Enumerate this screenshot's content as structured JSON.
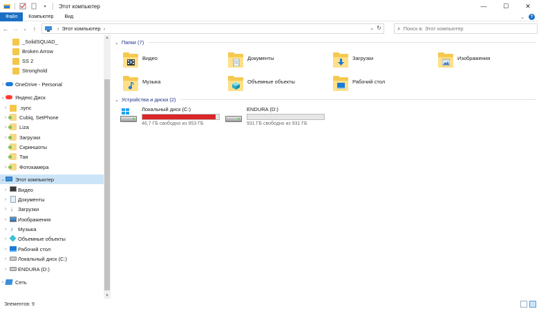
{
  "window": {
    "title": "Этот компьютер",
    "controls": {
      "minimize": "—",
      "maximize": "☐",
      "close": "✕"
    }
  },
  "ribbon": {
    "tabs": [
      "Файл",
      "Компьютер",
      "Вид"
    ],
    "active_tab": 0,
    "expand_icon": "chevron-down-icon",
    "help_icon": "help-icon"
  },
  "navigation": {
    "back": "←",
    "forward": "→",
    "recent": "⌄",
    "up": "↑",
    "address_segments": [
      "Этот компьютер"
    ],
    "search_placeholder": "Поиск в: Этот компьютер"
  },
  "sidebar": {
    "items": [
      {
        "label": "_SolidSQUAD_",
        "icon": "folder-icon",
        "expandable": false,
        "indent": 1
      },
      {
        "label": "Broken Arrow",
        "icon": "folder-icon",
        "expandable": false,
        "indent": 1
      },
      {
        "label": "SS 2",
        "icon": "folder-icon",
        "expandable": false,
        "indent": 1
      },
      {
        "label": "Stronghold",
        "icon": "folder-icon",
        "expandable": false,
        "indent": 1
      },
      {
        "label": "OneDrive - Personal",
        "icon": "onedrive-icon",
        "expandable": true,
        "indent": 0
      },
      {
        "label": "Яндекс.Диск",
        "icon": "yandex-disk-icon",
        "expandable": true,
        "indent": 0,
        "expanded": true
      },
      {
        "label": ".sync",
        "icon": "folder-icon",
        "expandable": true,
        "indent": 1
      },
      {
        "label": "Cubiq, SetPhone",
        "icon": "synced-folder-icon",
        "expandable": true,
        "indent": 1
      },
      {
        "label": "Liza",
        "icon": "synced-folder-icon",
        "expandable": true,
        "indent": 1
      },
      {
        "label": "Загрузки",
        "icon": "synced-folder-icon",
        "expandable": true,
        "indent": 1
      },
      {
        "label": "Скриншоты",
        "icon": "synced-folder-icon",
        "expandable": false,
        "indent": 1
      },
      {
        "label": "Тая",
        "icon": "synced-folder-icon",
        "expandable": false,
        "indent": 1
      },
      {
        "label": "Фотокамера",
        "icon": "synced-folder-icon",
        "expandable": true,
        "indent": 1
      },
      {
        "label": "Этот компьютер",
        "icon": "this-pc-icon",
        "expandable": true,
        "indent": 0,
        "expanded": true,
        "selected": true
      },
      {
        "label": "Видео",
        "icon": "video-folder-icon",
        "expandable": true,
        "indent": 1
      },
      {
        "label": "Документы",
        "icon": "documents-folder-icon",
        "expandable": true,
        "indent": 1
      },
      {
        "label": "Загрузки",
        "icon": "downloads-folder-icon",
        "expandable": true,
        "indent": 1
      },
      {
        "label": "Изображения",
        "icon": "pictures-folder-icon",
        "expandable": true,
        "indent": 1
      },
      {
        "label": "Музыка",
        "icon": "music-folder-icon",
        "expandable": true,
        "indent": 1
      },
      {
        "label": "Объемные объекты",
        "icon": "3d-objects-icon",
        "expandable": true,
        "indent": 1
      },
      {
        "label": "Рабочий стол",
        "icon": "desktop-folder-icon",
        "expandable": true,
        "indent": 1
      },
      {
        "label": "Локальный диск (C:)",
        "icon": "local-disk-icon",
        "expandable": true,
        "indent": 1
      },
      {
        "label": "ENDURA (D:)",
        "icon": "drive-icon",
        "expandable": true,
        "indent": 1
      },
      {
        "label": "Сеть",
        "icon": "network-icon",
        "expandable": true,
        "indent": 0
      }
    ]
  },
  "content": {
    "folders_header": "Папки (7)",
    "folders": [
      {
        "label": "Видео",
        "icon": "video-folder-icon"
      },
      {
        "label": "Документы",
        "icon": "documents-folder-icon"
      },
      {
        "label": "Загрузки",
        "icon": "downloads-folder-icon"
      },
      {
        "label": "Изображения",
        "icon": "pictures-folder-icon"
      },
      {
        "label": "Музыка",
        "icon": "music-folder-icon"
      },
      {
        "label": "Объемные объекты",
        "icon": "3d-objects-icon"
      },
      {
        "label": "Рабочий стол",
        "icon": "desktop-folder-icon"
      }
    ],
    "drives_header": "Устройства и диски (2)",
    "drives": [
      {
        "name": "Локальный диск (C:)",
        "free_text": "46,7 ГБ свободно из 953 ГБ",
        "used_fraction": 0.951,
        "bar_color": "#da2626",
        "icon": "local-disk-icon"
      },
      {
        "name": "ENDURA (D:)",
        "free_text": "931 ГБ свободно из 931 ГБ",
        "used_fraction": 0.0,
        "bar_color": "#26a0da",
        "icon": "drive-icon"
      }
    ]
  },
  "status": {
    "items_count": "Элементов: 9"
  },
  "colors": {
    "accent": "#1a6fc4",
    "selection": "#cce4f7",
    "group_header": "#1e3287",
    "folder": "#f5c951",
    "disk_full": "#da2626"
  }
}
